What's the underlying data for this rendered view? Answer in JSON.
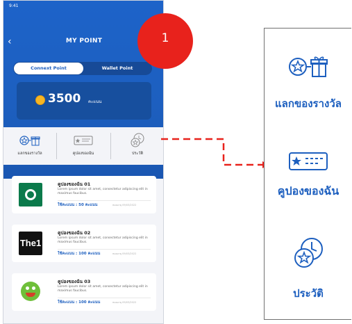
{
  "phone": {
    "status_time": "9:41",
    "title": "MY POINT",
    "tabs": [
      "Connext Point",
      "Wallet Point"
    ],
    "points_value": "3500",
    "points_unit": "คะแนน",
    "menu": [
      "แลกของรางวัล",
      "คูปองของฉัน",
      "ประวัติ"
    ],
    "coupons": [
      {
        "title": "คูปองของฉัน 01",
        "desc": "Lorem ipsum dolor sit amet, consectetur adipiscing elit in maximus faucibus.",
        "points": "ใช้คะแนน : 50",
        "unit": "คะแนน",
        "date": "หมดอายุ 09/03/2022"
      },
      {
        "title": "คูปองของฉัน 02",
        "desc": "Lorem ipsum dolor sit amet, consectetur adipiscing elit in maximus faucibus.",
        "points": "ใช้คะแนน : 100",
        "unit": "คะแนน",
        "date": "หมดอายุ 09/03/2022"
      },
      {
        "title": "คูปองของฉัน 03",
        "desc": "Lorem ipsum dolor sit amet, consectetur adipiscing elit in maximus faucibus.",
        "points": "ใช้คะแนน : 100",
        "unit": "คะแนน",
        "date": "หมดอายุ 09/03/2022"
      }
    ],
    "logo2_text": "The1"
  },
  "badge": "1",
  "panel": {
    "items": [
      "แลกของรางวัล",
      "คูปองของฉัน",
      "ประวัติ"
    ]
  },
  "colors": {
    "primary": "#1d5fbf",
    "badge": "#e8221c",
    "arrow": "#e8221c"
  },
  "icons": [
    "back-arrow-icon",
    "coin-icon",
    "star-gift-icon",
    "coupon-icon",
    "star-clock-icon"
  ]
}
